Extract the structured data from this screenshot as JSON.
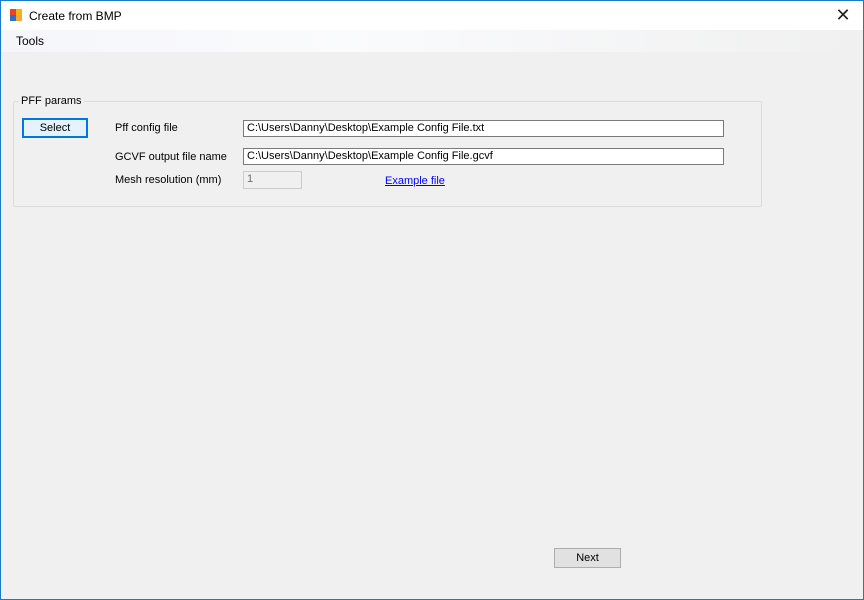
{
  "window": {
    "title": "Create from BMP",
    "icon": "bmp-app-icon",
    "close_glyph": "✕"
  },
  "menu": {
    "items": [
      {
        "label": "Tools"
      }
    ]
  },
  "pff_group": {
    "legend": "PFF params",
    "select_button": "Select",
    "config_label": "Pff config file",
    "config_value": "C:\\Users\\Danny\\Desktop\\Example Config File.txt",
    "output_label": "GCVF output file name",
    "output_value": "C:\\Users\\Danny\\Desktop\\Example Config File.gcvf",
    "mesh_label": "Mesh resolution (mm)",
    "mesh_value": "1",
    "example_link": "Example file"
  },
  "footer": {
    "next_button": "Next"
  },
  "colors": {
    "accent": "#0078d7",
    "link": "#0000ff",
    "window_border": "#1979ca"
  }
}
